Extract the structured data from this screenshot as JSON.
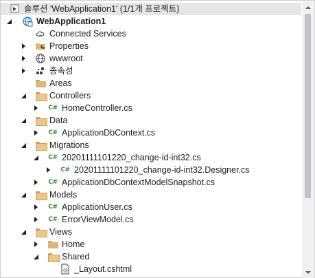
{
  "solution": {
    "label": "솔루션 'WebApplication1' (1/1개 프로젝트)"
  },
  "project": {
    "label": "WebApplication1"
  },
  "items": {
    "connected_services": "Connected Services",
    "properties": "Properties",
    "wwwroot": "wwwroot",
    "dependencies": "종속성",
    "areas": "Areas",
    "controllers": "Controllers",
    "home_controller": "HomeController.cs",
    "data": "Data",
    "app_db_context": "ApplicationDbContext.cs",
    "migrations": "Migrations",
    "migration_file": "20201111101220_change-id-int32.cs",
    "migration_designer": "20201111101220_change-id-int32.Designer.cs",
    "model_snapshot": "ApplicationDbContextModelSnapshot.cs",
    "models": "Models",
    "app_user": "ApplicationUser.cs",
    "error_view_model": "ErrorViewModel.cs",
    "views": "Views",
    "home": "Home",
    "shared": "Shared",
    "layout": "_Layout.cshtml"
  },
  "icons": {
    "csharp": "C#"
  },
  "colors": {
    "selected_row": "#e6e6e6",
    "folder": "#dcb67a",
    "csharp": "#388a34",
    "project_icon": "#1a7fd4",
    "scroll_thumb": "#c2c3c9"
  }
}
